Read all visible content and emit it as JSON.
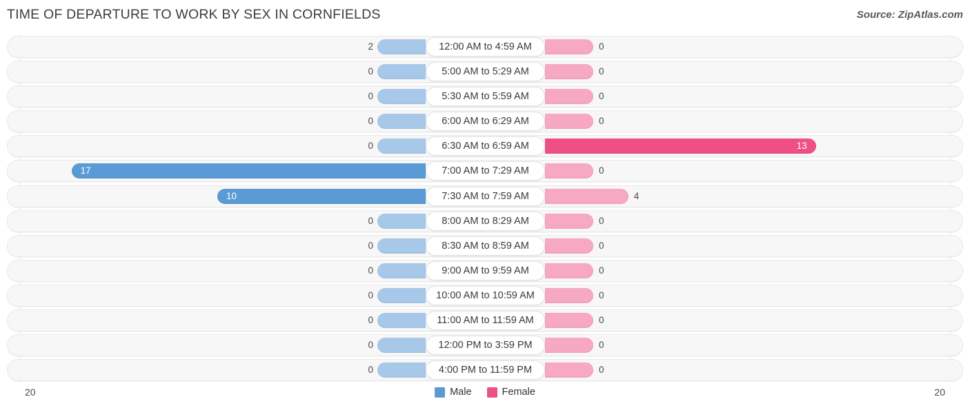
{
  "header": {
    "title": "TIME OF DEPARTURE TO WORK BY SEX IN CORNFIELDS",
    "source": "Source: ZipAtlas.com"
  },
  "legend": {
    "male_label": "Male",
    "female_label": "Female",
    "male_color": "#5b9bd5",
    "female_color": "#ee5084"
  },
  "axis": {
    "min_label": "20",
    "max_label": "20"
  },
  "chart_data": {
    "type": "bar",
    "orientation": "horizontal-diverging",
    "title": "TIME OF DEPARTURE TO WORK BY SEX IN CORNFIELDS",
    "xlabel": "",
    "ylabel": "",
    "xlim": [
      20,
      20
    ],
    "grid": true,
    "legend_position": "bottom-center",
    "categories": [
      "12:00 AM to 4:59 AM",
      "5:00 AM to 5:29 AM",
      "5:30 AM to 5:59 AM",
      "6:00 AM to 6:29 AM",
      "6:30 AM to 6:59 AM",
      "7:00 AM to 7:29 AM",
      "7:30 AM to 7:59 AM",
      "8:00 AM to 8:29 AM",
      "8:30 AM to 8:59 AM",
      "9:00 AM to 9:59 AM",
      "10:00 AM to 10:59 AM",
      "11:00 AM to 11:59 AM",
      "12:00 PM to 3:59 PM",
      "4:00 PM to 11:59 PM"
    ],
    "series": [
      {
        "name": "Male",
        "color": "#5b9bd5",
        "values": [
          2,
          0,
          0,
          0,
          0,
          17,
          10,
          0,
          0,
          0,
          0,
          0,
          0,
          0
        ]
      },
      {
        "name": "Female",
        "color": "#ee5084",
        "values": [
          0,
          0,
          0,
          0,
          13,
          0,
          4,
          0,
          0,
          0,
          0,
          0,
          0,
          0
        ]
      }
    ]
  },
  "rows": [
    {
      "label": "12:00 AM to 4:59 AM",
      "male": "2",
      "female": "0"
    },
    {
      "label": "5:00 AM to 5:29 AM",
      "male": "0",
      "female": "0"
    },
    {
      "label": "5:30 AM to 5:59 AM",
      "male": "0",
      "female": "0"
    },
    {
      "label": "6:00 AM to 6:29 AM",
      "male": "0",
      "female": "0"
    },
    {
      "label": "6:30 AM to 6:59 AM",
      "male": "0",
      "female": "13"
    },
    {
      "label": "7:00 AM to 7:29 AM",
      "male": "17",
      "female": "0"
    },
    {
      "label": "7:30 AM to 7:59 AM",
      "male": "10",
      "female": "4"
    },
    {
      "label": "8:00 AM to 8:29 AM",
      "male": "0",
      "female": "0"
    },
    {
      "label": "8:30 AM to 8:59 AM",
      "male": "0",
      "female": "0"
    },
    {
      "label": "9:00 AM to 9:59 AM",
      "male": "0",
      "female": "0"
    },
    {
      "label": "10:00 AM to 10:59 AM",
      "male": "0",
      "female": "0"
    },
    {
      "label": "11:00 AM to 11:59 AM",
      "male": "0",
      "female": "0"
    },
    {
      "label": "12:00 PM to 3:59 PM",
      "male": "0",
      "female": "0"
    },
    {
      "label": "4:00 PM to 11:59 PM",
      "male": "0",
      "female": "0"
    }
  ]
}
